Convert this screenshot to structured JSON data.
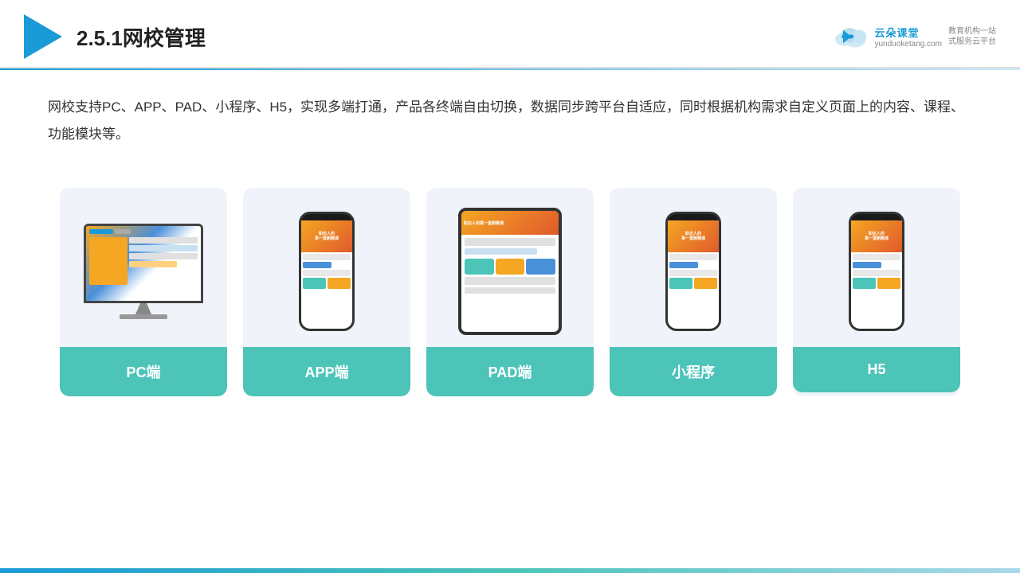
{
  "header": {
    "title": "2.5.1网校管理",
    "brand": {
      "name": "云朵课堂",
      "url": "yunduoketang.com",
      "slogan": "教育机构一站\n式服务云平台"
    }
  },
  "description": {
    "text": "网校支持PC、APP、PAD、小程序、H5，实现多端打通，产品各终端自由切换，数据同步跨平台自适应，同时根据机构需求自定义页面上的内容、课程、功能模块等。"
  },
  "cards": [
    {
      "label": "PC端",
      "type": "pc"
    },
    {
      "label": "APP端",
      "type": "phone"
    },
    {
      "label": "PAD端",
      "type": "tablet"
    },
    {
      "label": "小程序",
      "type": "phone"
    },
    {
      "label": "H5",
      "type": "phone"
    }
  ],
  "colors": {
    "accent": "#1a9ad7",
    "teal": "#4cc4b8",
    "dark": "#222",
    "label_bg": "#4cc4b8"
  }
}
